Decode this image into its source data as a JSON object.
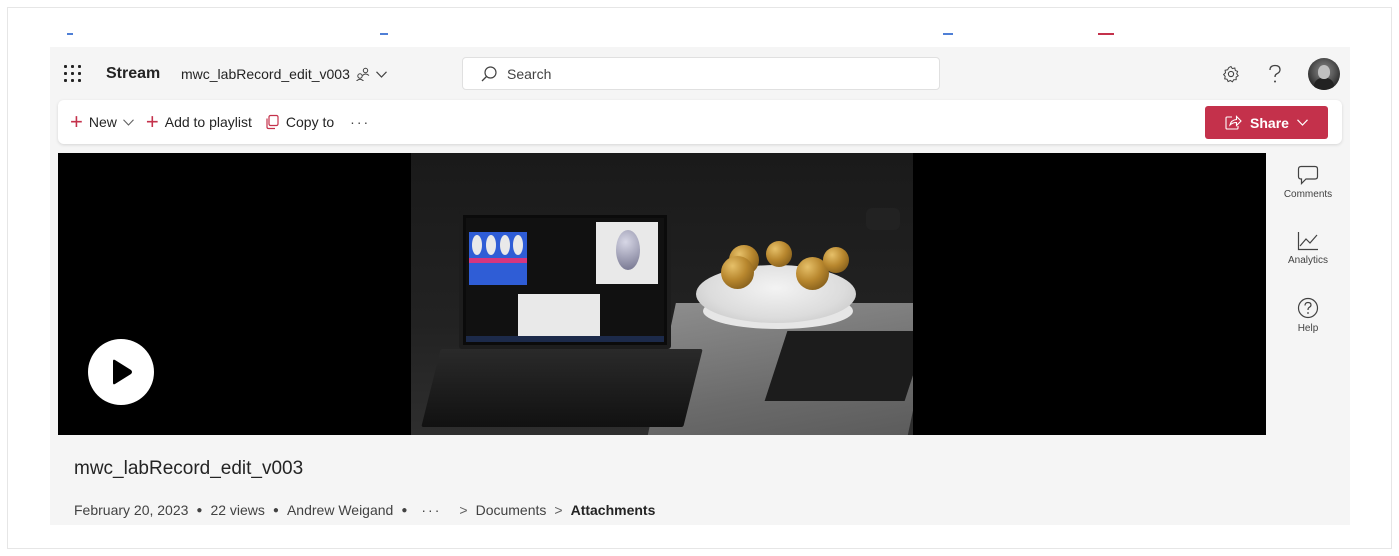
{
  "header": {
    "app_name": "Stream",
    "doc_title": "mwc_labRecord_edit_v003",
    "search_placeholder": "Search",
    "icons": [
      "waffle-icon",
      "people-icon",
      "chevron-down-icon",
      "search-icon",
      "settings-icon",
      "help-icon",
      "avatar"
    ]
  },
  "commands": {
    "new_label": "New",
    "add_playlist_label": "Add to playlist",
    "copy_to_label": "Copy to",
    "more_label": "···",
    "share_label": "Share"
  },
  "rail": {
    "items": [
      {
        "label": "Comments",
        "icon": "comment-icon"
      },
      {
        "label": "Analytics",
        "icon": "analytics-icon"
      },
      {
        "label": "Help",
        "icon": "help-circle-icon"
      }
    ]
  },
  "video": {
    "title": "mwc_labRecord_edit_v003",
    "date": "February 20, 2023",
    "views": "22 views",
    "author": "Andrew Weigand",
    "breadcrumb_more": "···",
    "breadcrumb": [
      "Documents",
      "Attachments"
    ]
  },
  "colors": {
    "accent": "#c4314b",
    "background": "#f5f5f5",
    "player": "#000000"
  }
}
